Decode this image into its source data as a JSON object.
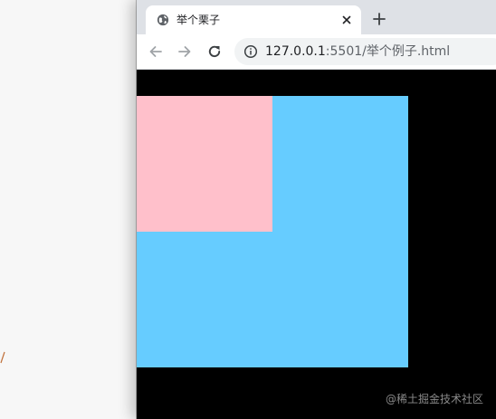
{
  "browser": {
    "tab_title": "举个栗子",
    "url_host": "127.0.0.1",
    "url_rest": ":5501/举个例子.html"
  },
  "page": {
    "outer_box_color": "#66ccff",
    "inner_box_color": "#ffc0cb",
    "background_color": "#000000"
  },
  "watermark": "@稀土掘金技术社区",
  "icons": {
    "tab_favicon": "globe-icon",
    "tab_close": "close-icon",
    "new_tab": "plus-icon",
    "back": "back-arrow-icon",
    "forward": "forward-arrow-icon",
    "reload": "reload-icon",
    "site_info": "info-icon"
  }
}
